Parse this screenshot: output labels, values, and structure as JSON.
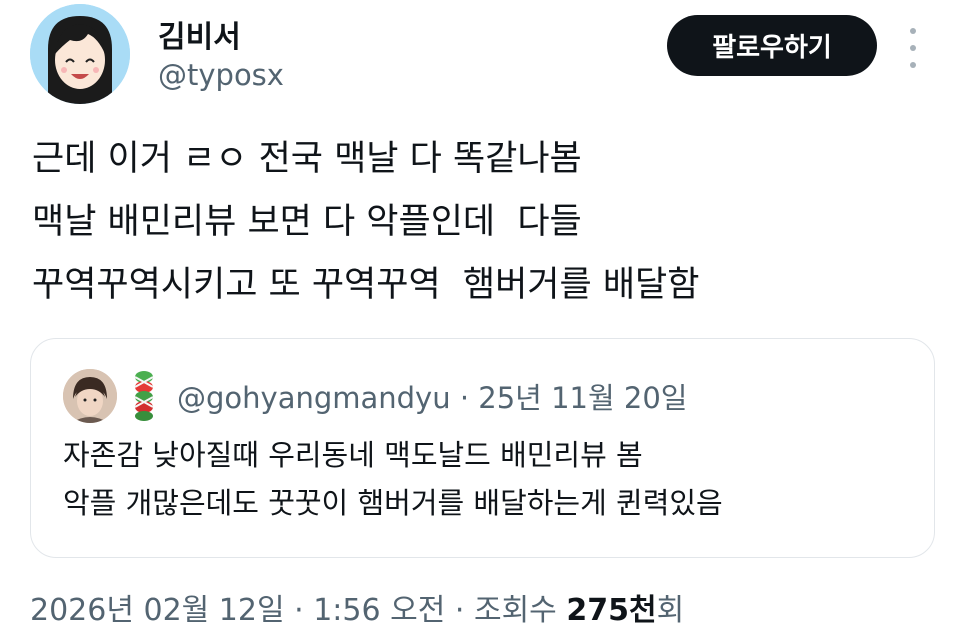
{
  "author": {
    "display_name": "김비서",
    "handle": "@typosx",
    "avatar_icon": "anime-girl-avatar"
  },
  "follow_button_label": "팔로우하기",
  "more_icon": "more-vertical-icon",
  "tweet": {
    "lines": [
      "근데 이거 ㄹㅇ 전국 맥날 다 똑같나봄",
      "맥날 배민리뷰 보면 다 악플인데  다들",
      "꾸역꾸역시키고 또 꾸역꾸역  햄버거를 배달함"
    ]
  },
  "quote": {
    "avatar_icon": "person-avatar",
    "emoji_icon": "braid-emoji-icon",
    "handle": "@gohyangmandyu",
    "separator": "·",
    "date": "25년 11월 20일",
    "lines": [
      "자존감 낮아질때 우리동네 맥도날드 배민리뷰 봄",
      "악플 개많은데도 꿋꿋이 햄버거를 배달하는게 퀸력있음"
    ]
  },
  "footer": {
    "date": "2026년 02월 12일",
    "separator": "·",
    "time": "1:56 오전",
    "views_label": "조회수",
    "views_count": "275천",
    "views_suffix": "회"
  },
  "colors": {
    "primary_text": "#0f1419",
    "secondary_text": "#536471",
    "button_bg": "#0f1419",
    "border": "#e2e6ea"
  }
}
